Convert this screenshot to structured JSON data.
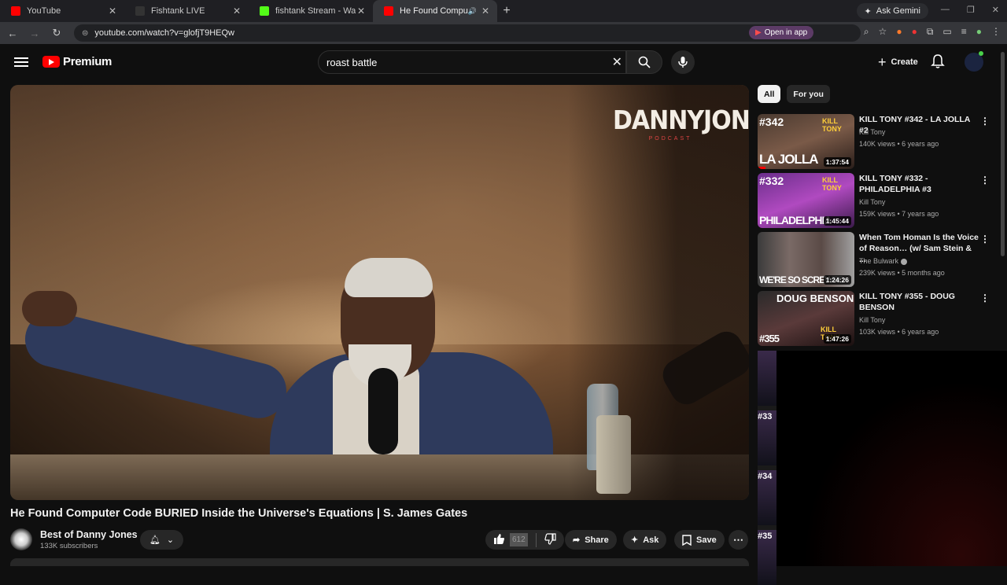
{
  "browser": {
    "tabs": [
      {
        "title": "YouTube",
        "favicon_color": "#ff0000"
      },
      {
        "title": "Fishtank LIVE",
        "favicon_color": "#222222"
      },
      {
        "title": "fishtank Stream - Watch Live o",
        "favicon_color": "#53fc18"
      },
      {
        "title": "He Found Computer Code",
        "favicon_color": "#ff0000"
      }
    ],
    "gemini_label": "Ask Gemini",
    "url": "youtube.com/watch?v=glofjT9HEQw",
    "open_in_app": "Open in app"
  },
  "header": {
    "logo_text": "Premium",
    "search_value": "roast battle",
    "create_label": "Create"
  },
  "video": {
    "brand_main": "DANNYJONES",
    "brand_sub": "PODCAST",
    "title": "He Found Computer Code BURIED Inside the Universe's Equations | S. James Gates"
  },
  "channel": {
    "name": "Best of Danny Jones",
    "subscribers": "133K subscribers"
  },
  "actions": {
    "like_count": "612",
    "share": "Share",
    "ask": "Ask",
    "save": "Save"
  },
  "sidebar": {
    "chips": [
      "All",
      "For you"
    ],
    "recommendations": [
      {
        "title": "KILL TONY #342 - LA JOLLA #2",
        "channel": "Kill Tony",
        "meta": "140K views • 6 years ago",
        "duration": "1:37:54",
        "thumb_top": "#342",
        "thumb_bottom": "LA JOLLA",
        "thumb_tag": "KILL TONY"
      },
      {
        "title": "KILL TONY #332 - PHILADELPHIA #3",
        "channel": "Kill Tony",
        "meta": "159K views • 7 years ago",
        "duration": "1:45:44",
        "thumb_top": "#332",
        "thumb_bottom": "PHILADELPHIA",
        "thumb_tag": "KILL TONY"
      },
      {
        "title": "When Tom Homan Is the Voice of Reason… (w/ Sam Stein & ...",
        "channel": "The Bulwark",
        "meta": "239K views • 5 months ago",
        "duration": "1:24:26",
        "thumb_top": "",
        "thumb_bottom": "WE'RE SO SCREWED",
        "thumb_tag": ""
      },
      {
        "title": "KILL TONY #355 - DOUG BENSON",
        "channel": "Kill Tony",
        "meta": "103K views • 6 years ago",
        "duration": "1:47:26",
        "thumb_top": "DOUG BENSON",
        "thumb_bottom": "#355",
        "thumb_tag": "KILL TONY"
      }
    ],
    "strip_labels": [
      "#33",
      "#34",
      "#35"
    ]
  }
}
